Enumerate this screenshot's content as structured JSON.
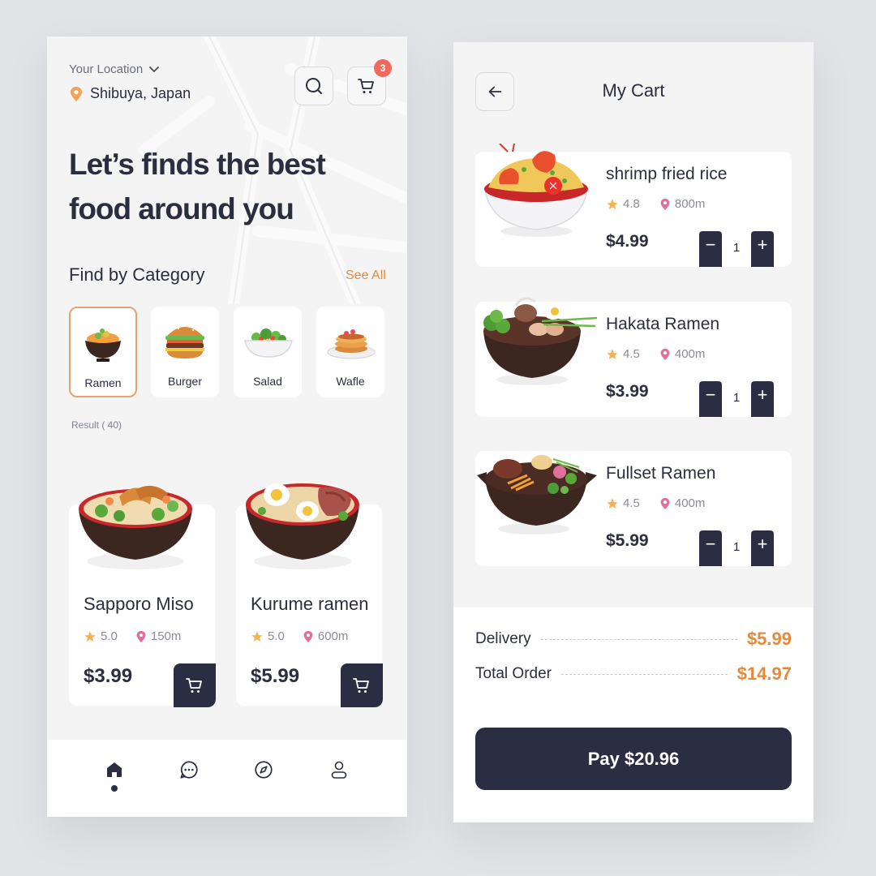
{
  "colors": {
    "accent": "#e58a3c",
    "dark": "#2b2e42",
    "badge": "#ef6a5a",
    "active_border": "#e9a06c",
    "star": "#f2b352",
    "pin": "#e0709b"
  },
  "home": {
    "location_label": "Your Location",
    "location_value": "Shibuya, Japan",
    "cart_badge": "3",
    "hero_line1": "Let’s finds the best",
    "hero_line2": "food around you",
    "category_title": "Find by Category",
    "see_all": "See All",
    "categories": [
      {
        "label": "Ramen",
        "icon": "ramen-bowl-icon",
        "active": true
      },
      {
        "label": "Burger",
        "icon": "burger-icon",
        "active": false
      },
      {
        "label": "Salad",
        "icon": "salad-icon",
        "active": false
      },
      {
        "label": "Wafle",
        "icon": "pancake-icon",
        "active": false
      }
    ],
    "result": "Result ( 40)",
    "foods": [
      {
        "name": "Sapporo Miso",
        "rating": "5.0",
        "distance": "150m",
        "price": "$3.99"
      },
      {
        "name": "Kurume ramen",
        "rating": "5.0",
        "distance": "600m",
        "price": "$5.99"
      }
    ],
    "nav": [
      "home-icon",
      "chat-icon",
      "compass-icon",
      "profile-icon"
    ]
  },
  "cart": {
    "title": "My Cart",
    "items": [
      {
        "name": "shrimp fried rice",
        "rating": "4.8",
        "distance": "800m",
        "price": "$4.99",
        "qty": "1",
        "minus": "−",
        "plus": "+"
      },
      {
        "name": "Hakata Ramen",
        "rating": "4.5",
        "distance": "400m",
        "price": "$3.99",
        "qty": "1",
        "minus": "−",
        "plus": "+"
      },
      {
        "name": "Fullset Ramen",
        "rating": "4.5",
        "distance": "400m",
        "price": "$5.99",
        "qty": "1",
        "minus": "−",
        "plus": "+"
      }
    ],
    "delivery_label": "Delivery",
    "delivery_value": "$5.99",
    "total_label": "Total Order",
    "total_value": "$14.97",
    "pay_label": "Pay $20.96"
  }
}
